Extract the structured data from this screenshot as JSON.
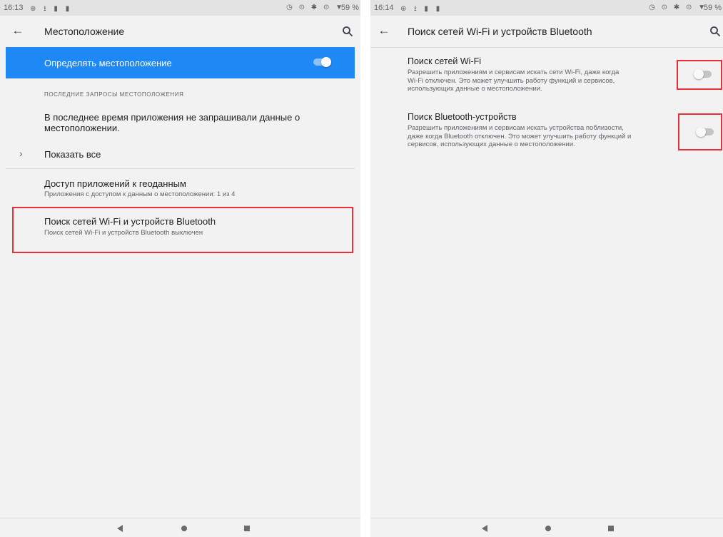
{
  "colors": {
    "accent": "#1e88f5",
    "highlight_box": "#e8303a",
    "background": "#f2f2f2",
    "statusbar": "#e3e3e3"
  },
  "left": {
    "statusbar": {
      "time": "16:13",
      "left_icons": "⊕ ⭳ ▮ ▮",
      "right_icons": "◷ ⊙ ✱ ⊙ ▼",
      "battery": "59 %"
    },
    "toolbar": {
      "back_icon": "arrow-back-icon",
      "title": "Местоположение",
      "search_icon": "search-icon"
    },
    "master_switch": {
      "label": "Определять местоположение",
      "enabled": true
    },
    "recent_requests": {
      "header": "ПОСЛЕДНИЕ ЗАПРОСЫ МЕСТОПОЛОЖЕНИЯ",
      "message_line1": "В последнее время приложения не запрашивали данные о",
      "message_line2": "местоположении."
    },
    "show_all": {
      "label": "Показать все",
      "icon": "chevron-right-icon"
    },
    "app_access": {
      "title": "Доступ приложений к геоданным",
      "summary": "Приложения с доступом к данным о местоположении: 1 из 4"
    },
    "scanning": {
      "title": "Поиск сетей Wi-Fi и устройств Bluetooth",
      "summary": "Поиск сетей Wi-Fi и устройств Bluetooth выключен"
    }
  },
  "right": {
    "statusbar": {
      "time": "16:14",
      "left_icons": "⊕ ⭳ ▮ ▮",
      "right_icons": "◷ ⊙ ✱ ⊙ ▼",
      "battery": "59 %"
    },
    "toolbar": {
      "back_icon": "arrow-back-icon",
      "title": "Поиск сетей Wi-Fi и устройств Bluetooth",
      "search_icon": "search-icon"
    },
    "wifi_scanning": {
      "title": "Поиск сетей Wi-Fi",
      "summary_line1": "Разрешить приложениям и сервисам искать сети Wi-Fi, даже когда",
      "summary_line2": "Wi-Fi отключен. Это может улучшить работу функций и сервисов,",
      "summary_line3": "использующих данные о местоположении.",
      "enabled": false
    },
    "bt_scanning": {
      "title": "Поиск Bluetooth-устройств",
      "summary_line1": "Разрешить приложениям и сервисам искать устройства поблизости,",
      "summary_line2": "даже когда Bluetooth отключен. Это может улучшить работу функций и",
      "summary_line3": "сервисов, использующих данные о местоположении.",
      "enabled": false
    }
  },
  "navbar": {
    "back_icon": "nav-back-icon",
    "home_icon": "nav-home-icon",
    "recents_icon": "nav-recents-icon"
  }
}
